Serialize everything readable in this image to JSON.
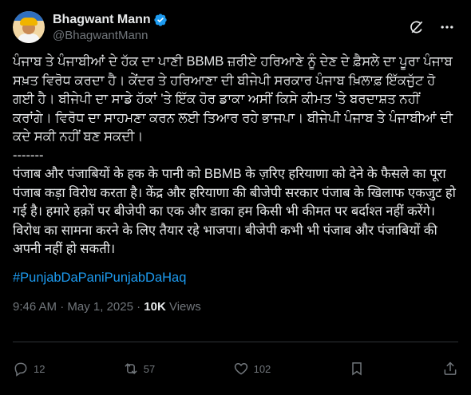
{
  "author": {
    "display_name": "Bhagwant Mann",
    "handle": "@BhagwantMann"
  },
  "header": {
    "icons": [
      "grok-icon",
      "more-icon"
    ]
  },
  "tweet": {
    "punjabi_text": "ਪੰਜਾਬ ਤੇ ਪੰਜਾਬੀਆਂ ਦੇ ਹੱਕ ਦਾ ਪਾਣੀ BBMB ਜ਼ਰੀਏ ਹਰਿਆਣੇ ਨੂੰ ਦੇਣ ਦੇ ਫ਼ੈਸਲੇ ਦਾ ਪੂਰਾ ਪੰਜਾਬ ਸਖ਼ਤ ਵਿਰੋਧ ਕਰਦਾ ਹੈ। ਕੇਂਦਰ ਤੇ ਹਰਿਆਣਾ ਦੀ ਬੀਜੇਪੀ ਸਰਕਾਰ ਪੰਜਾਬ ਖ਼ਿਲਾਫ਼ ਇੱਕਜੁੱਟ ਹੋ ਗਈ ਹੈ। ਬੀਜੇਪੀ ਦਾ ਸਾਡੇ ਹੱਕਾਂ 'ਤੇ ਇੱਕ ਹੋਰ ਡਾਕਾ ਅਸੀਂ ਕਿਸੇ ਕੀਮਤ 'ਤੇ ਬਰਦਾਸ਼ਤ ਨਹੀਂ ਕਰਾਂਗੇ। ਵਿਰੋਧ ਦਾ ਸਾਹਮਣਾ ਕਰਨ ਲਈ ਤਿਆਰ ਰਹੇ ਭਾਜਪਾ। ਬੀਜੇਪੀ ਪੰਜਾਬ ਤੇ ਪੰਜਾਬੀਆਂ ਦੀ ਕਦੇ ਸਕੀ ਨਹੀਂ ਬਣ ਸਕਦੀ।",
    "separator": "-------",
    "hindi_text": "पंजाब और पंजाबियों के हक के पानी को BBMB के ज़रिए हरियाणा को देने के फैसले का पूरा पंजाब कड़ा विरोध करता है। केंद्र और हरियाणा की बीजेपी सरकार पंजाब के खिलाफ एकजुट हो गई है। हमारे हक़ों पर बीजेपी का एक और डाका हम किसी भी कीमत पर बर्दाश्त नहीं करेंगे। विरोध का सामना करने के लिए तैयार रहे भाजपा। बीजेपी कभी भी पंजाब और पंजाबियों की अपनी नहीं हो सकती।",
    "hashtag": "#PunjabDaPaniPunjabDaHaq",
    "time": "9:46 AM",
    "dot": " · ",
    "date": "May 1, 2025",
    "views_count": "10K",
    "views_label": " Views"
  },
  "actions": {
    "replies": "12",
    "reposts": "57",
    "likes": "102"
  },
  "colors": {
    "background": "#000000",
    "text": "#e7e9ea",
    "muted": "#71767b",
    "accent": "#1d9bf0",
    "divider": "#2f3336"
  }
}
